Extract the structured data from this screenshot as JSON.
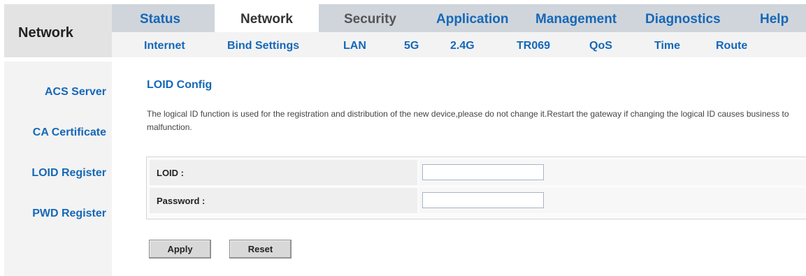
{
  "header": {
    "section_title": "Network"
  },
  "top_tabs": [
    {
      "label": "Status"
    },
    {
      "label": "Network"
    },
    {
      "label": "Security"
    },
    {
      "label": "Application"
    },
    {
      "label": "Management"
    },
    {
      "label": "Diagnostics"
    },
    {
      "label": "Help"
    }
  ],
  "sub_tabs": [
    {
      "label": "Internet"
    },
    {
      "label": "Bind Settings"
    },
    {
      "label": "LAN"
    },
    {
      "label": "5G"
    },
    {
      "label": "2.4G"
    },
    {
      "label": "TR069"
    },
    {
      "label": "QoS"
    },
    {
      "label": "Time"
    },
    {
      "label": "Route"
    }
  ],
  "sidebar": {
    "items": [
      {
        "label": "ACS Server"
      },
      {
        "label": "CA Certificate"
      },
      {
        "label": "LOID Register"
      },
      {
        "label": "PWD Register"
      }
    ]
  },
  "main": {
    "title": "LOID Config",
    "description": "The logical ID function is used for the registration and distribution of the new device,please do not change it.Restart the gateway if changing the logical ID causes business to malfunction.",
    "fields": [
      {
        "label": "LOID :",
        "value": ""
      },
      {
        "label": "Password :",
        "value": ""
      }
    ],
    "apply_label": "Apply",
    "reset_label": "Reset"
  },
  "colors": {
    "link_blue": "#1668b7",
    "top_bar": "#d0d5dc",
    "sub_bar": "#f3f3f3",
    "panel_gray": "#e3e3e3"
  }
}
